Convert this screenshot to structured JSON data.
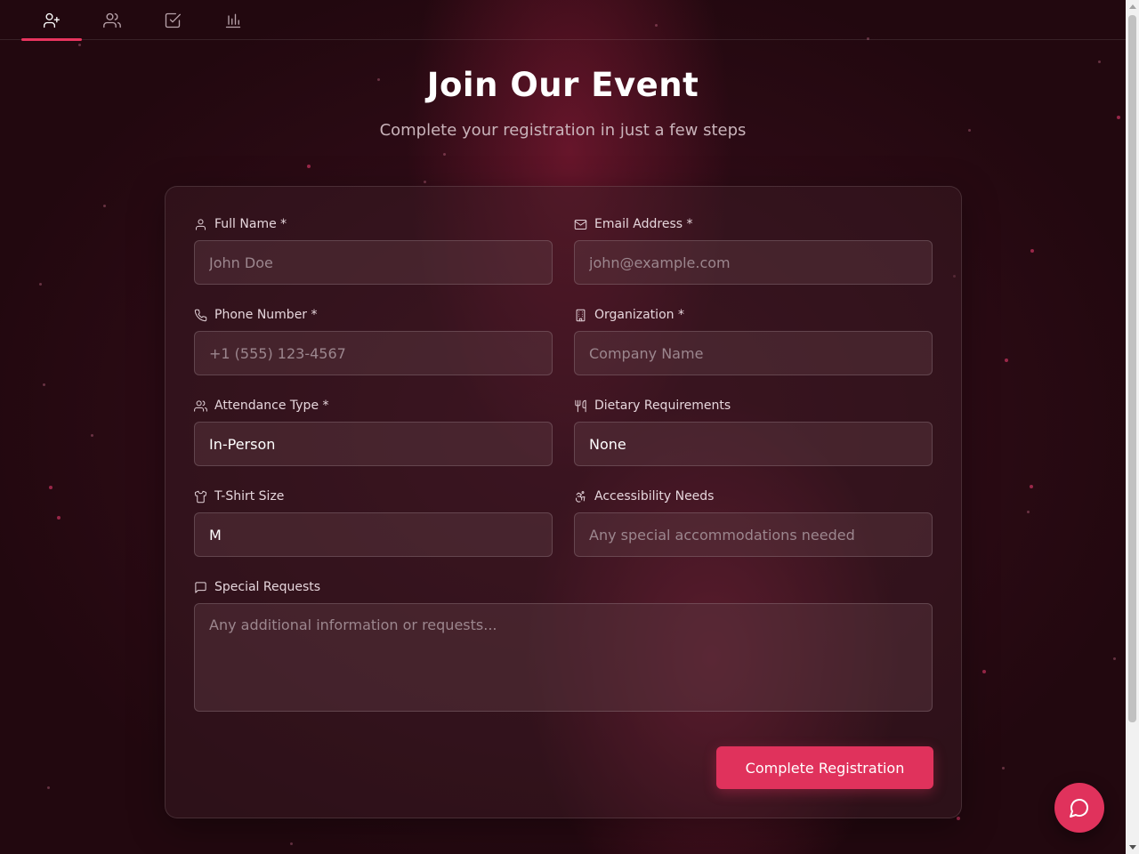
{
  "nav": {
    "tabs": [
      {
        "icon": "user-plus-icon",
        "active": true
      },
      {
        "icon": "users-icon",
        "active": false
      },
      {
        "icon": "check-square-icon",
        "active": false
      },
      {
        "icon": "bar-chart-icon",
        "active": false
      }
    ]
  },
  "header": {
    "title": "Join Our Event",
    "subtitle": "Complete your registration in just a few steps"
  },
  "form": {
    "full_name": {
      "label": "Full Name *",
      "placeholder": "John Doe",
      "icon": "user-icon"
    },
    "email": {
      "label": "Email Address *",
      "placeholder": "john@example.com",
      "icon": "mail-icon"
    },
    "phone": {
      "label": "Phone Number *",
      "placeholder": "+1 (555) 123-4567",
      "icon": "phone-icon"
    },
    "organization": {
      "label": "Organization *",
      "placeholder": "Company Name",
      "icon": "building-icon"
    },
    "attendance_type": {
      "label": "Attendance Type *",
      "value": "In-Person",
      "icon": "users-icon"
    },
    "dietary": {
      "label": "Dietary Requirements",
      "value": "None",
      "icon": "utensils-icon"
    },
    "tshirt": {
      "label": "T-Shirt Size",
      "value": "M",
      "icon": "shirt-icon"
    },
    "accessibility": {
      "label": "Accessibility Needs",
      "placeholder": "Any special accommodations needed",
      "icon": "accessibility-icon"
    },
    "special_requests": {
      "label": "Special Requests",
      "placeholder": "Any additional information or requests...",
      "icon": "message-square-icon"
    },
    "submit_label": "Complete Registration"
  },
  "chat": {
    "icon": "message-circle-icon"
  },
  "colors": {
    "accent": "#e0325c",
    "background": "#2a0a15"
  }
}
